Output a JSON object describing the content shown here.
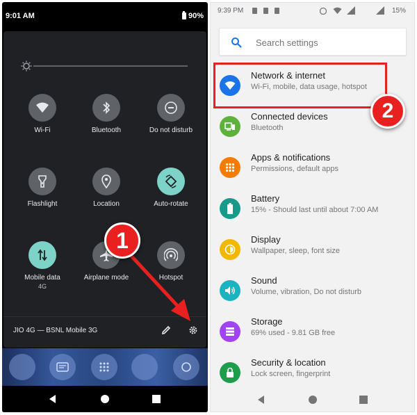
{
  "left_phone": {
    "status_bar": {
      "time": "9:01 AM",
      "battery": "90%"
    },
    "brightness_level": 0.0,
    "tiles": [
      {
        "label": "Wi-Fi",
        "sublabel": "",
        "icon": "wifi-icon",
        "active": false
      },
      {
        "label": "Bluetooth",
        "sublabel": "",
        "icon": "bluetooth-icon",
        "active": false
      },
      {
        "label": "Do not disturb",
        "sublabel": "",
        "icon": "do-not-disturb-icon",
        "active": false
      },
      {
        "label": "Flashlight",
        "sublabel": "",
        "icon": "flashlight-icon",
        "active": false
      },
      {
        "label": "Location",
        "sublabel": "",
        "icon": "location-icon",
        "active": false
      },
      {
        "label": "Auto-rotate",
        "sublabel": "",
        "icon": "auto-rotate-icon",
        "active": true
      },
      {
        "label": "Mobile data",
        "sublabel": "4G",
        "icon": "mobile-data-icon",
        "active": true
      },
      {
        "label": "Airplane mode",
        "sublabel": "",
        "icon": "airplane-icon",
        "active": false
      },
      {
        "label": "Hotspot",
        "sublabel": "",
        "icon": "hotspot-icon",
        "active": false
      }
    ],
    "footer": {
      "carrier": "JIO 4G — BSNL Mobile 3G"
    },
    "callout": "1"
  },
  "right_phone": {
    "status_bar": {
      "time": "9:39 PM",
      "battery": "15%"
    },
    "search": {
      "placeholder": "Search settings"
    },
    "items": [
      {
        "title": "Network & internet",
        "subtitle": "Wi-Fi, mobile, data usage, hotspot",
        "icon": "wifi-icon",
        "color": "#1a73e8"
      },
      {
        "title": "Connected devices",
        "subtitle": "Bluetooth",
        "icon": "connected-devices-icon",
        "color": "#5fb13e"
      },
      {
        "title": "Apps & notifications",
        "subtitle": "Permissions, default apps",
        "icon": "apps-icon",
        "color": "#f57c00"
      },
      {
        "title": "Battery",
        "subtitle": "15% - Should last until about 7:00 AM",
        "icon": "battery-icon",
        "color": "#169b8a"
      },
      {
        "title": "Display",
        "subtitle": "Wallpaper, sleep, font size",
        "icon": "brightness-icon",
        "color": "#f2b800"
      },
      {
        "title": "Sound",
        "subtitle": "Volume, vibration, Do not disturb",
        "icon": "volume-icon",
        "color": "#1bb3bf"
      },
      {
        "title": "Storage",
        "subtitle": "69% used - 9.81 GB free",
        "icon": "storage-icon",
        "color": "#a142f4"
      },
      {
        "title": "Security & location",
        "subtitle": "Lock screen, fingerprint",
        "icon": "lock-icon",
        "color": "#1e9e4a"
      }
    ],
    "callout": "2"
  },
  "colors": {
    "callout_red": "#e8201f",
    "tile_active": "#7ed3c8",
    "tile_inactive": "#5f6368",
    "panel_bg": "#202124"
  }
}
